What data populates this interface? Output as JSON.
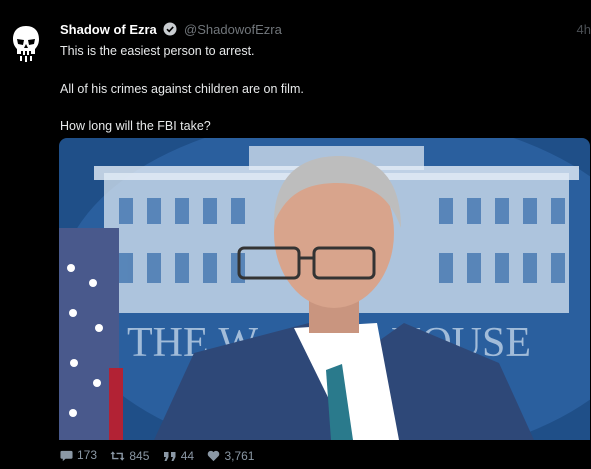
{
  "post": {
    "display_name": "Shadow of Ezra",
    "handle": "@ShadowofEzra",
    "timestamp": "4h",
    "lines": [
      "This is the easiest person to arrest.",
      "All of his crimes against children are on film.",
      "How long will the FBI take?"
    ],
    "media": {
      "backdrop_text": [
        "THE W",
        "HOUSE"
      ]
    },
    "stats": {
      "replies": "173",
      "reposts": "845",
      "quotes": "44",
      "likes": "3,761"
    }
  },
  "icons": {
    "avatar": "skull-icon",
    "verified": "verified-badge-icon",
    "replies": "comment-icon",
    "reposts": "repost-icon",
    "quotes": "quote-icon",
    "likes": "heart-icon"
  },
  "colors": {
    "background": "#000000",
    "text": "#e7e9ea",
    "handle": "#71767b",
    "stats": "#8b98a5",
    "backdrop_blue": "#2a5f9e"
  }
}
